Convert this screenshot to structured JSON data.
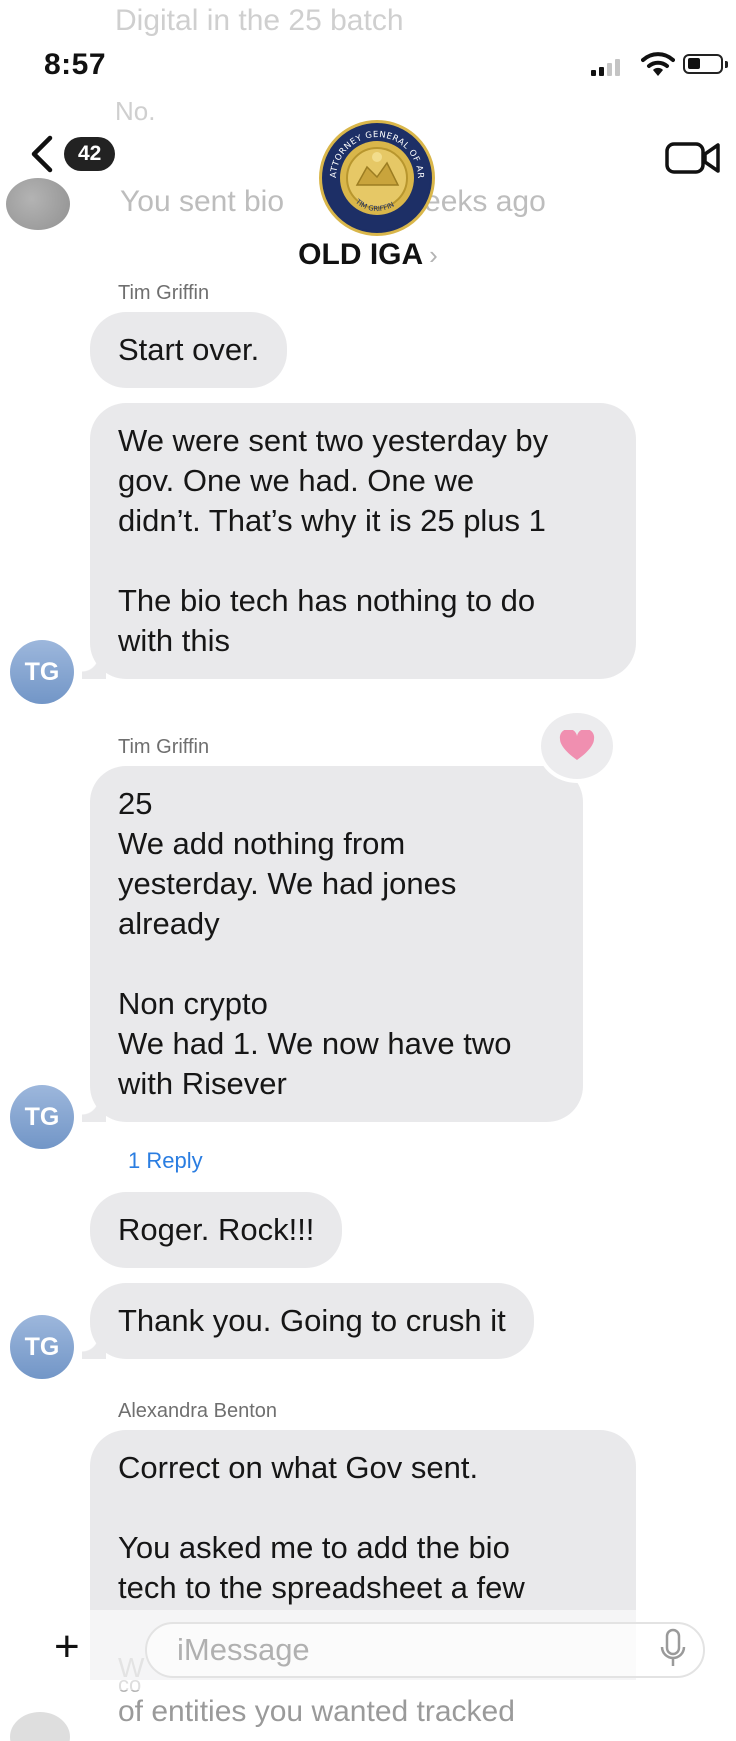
{
  "ghost_text": {
    "top_line": "Digital in the 25 batch",
    "second_line": "No.",
    "third_line": "You sent bio",
    "third_line_end": "eeks ago",
    "bottom_line_1": "W",
    "bottom_line_1_b": "co",
    "bottom_line_2": "of entities you wanted tracked"
  },
  "status_bar": {
    "time": "8:57",
    "signal_icon": "cellular-signal-icon",
    "wifi_icon": "wifi-icon",
    "battery_icon": "battery-icon"
  },
  "header": {
    "unread_count": "42",
    "group_name": "OLD IGA",
    "group_chevron": "›",
    "avatar_seal_top": "ATTORNEY GENERAL OF ARKANSAS",
    "avatar_seal_bottom": "TIM GRIFFIN",
    "colors": {
      "seal_blue": "#1d2f66",
      "seal_gold": "#d9b64a"
    }
  },
  "messages": [
    {
      "sender": "Tim Griffin",
      "text": "Start over."
    },
    {
      "text": "We were sent two yesterday by\ngov. One we had. One we\ndidn’t. That’s why it is 25 plus 1\n\nThe bio tech has nothing to do\nwith this",
      "avatar": "TG"
    },
    {
      "sender": "Tim Griffin",
      "text": "25\nWe add nothing from\nyesterday. We had jones\nalready\n\nNon crypto\nWe had 1. We now have two\nwith Risever",
      "avatar": "TG",
      "reaction": "heart",
      "reply_count": "1 Reply"
    },
    {
      "text": "Roger. Rock!!!"
    },
    {
      "text": "Thank you. Going to crush it",
      "avatar": "TG"
    },
    {
      "sender": "Alexandra Benton",
      "text": "Correct on what Gov sent.\n\nYou asked me to add the bio\ntech to the spreadsheet a few"
    }
  ],
  "compose": {
    "placeholder": "iMessage",
    "plus": "+",
    "colors": {
      "bubble": "#e9e9eb",
      "avatar": "#7f9fcf",
      "reply_link": "#2a7de1",
      "reaction_heart": "#f08fb0"
    }
  }
}
